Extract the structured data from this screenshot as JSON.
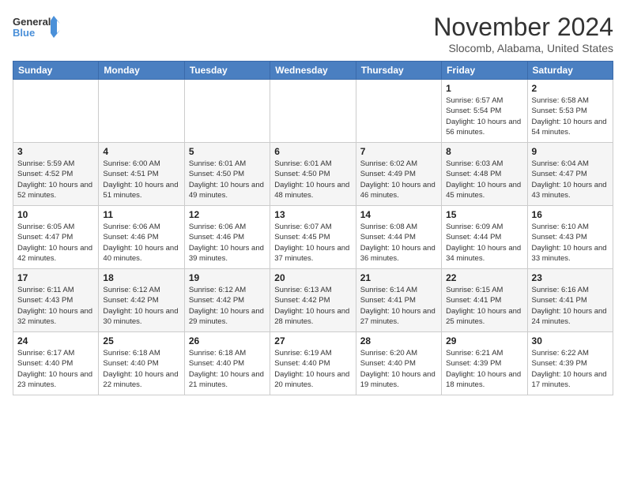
{
  "logo": {
    "line1": "General",
    "line2": "Blue"
  },
  "title": "November 2024",
  "location": "Slocomb, Alabama, United States",
  "days_of_week": [
    "Sunday",
    "Monday",
    "Tuesday",
    "Wednesday",
    "Thursday",
    "Friday",
    "Saturday"
  ],
  "weeks": [
    [
      {
        "day": "",
        "info": ""
      },
      {
        "day": "",
        "info": ""
      },
      {
        "day": "",
        "info": ""
      },
      {
        "day": "",
        "info": ""
      },
      {
        "day": "",
        "info": ""
      },
      {
        "day": "1",
        "info": "Sunrise: 6:57 AM\nSunset: 5:54 PM\nDaylight: 10 hours and 56 minutes."
      },
      {
        "day": "2",
        "info": "Sunrise: 6:58 AM\nSunset: 5:53 PM\nDaylight: 10 hours and 54 minutes."
      }
    ],
    [
      {
        "day": "3",
        "info": "Sunrise: 5:59 AM\nSunset: 4:52 PM\nDaylight: 10 hours and 52 minutes."
      },
      {
        "day": "4",
        "info": "Sunrise: 6:00 AM\nSunset: 4:51 PM\nDaylight: 10 hours and 51 minutes."
      },
      {
        "day": "5",
        "info": "Sunrise: 6:01 AM\nSunset: 4:50 PM\nDaylight: 10 hours and 49 minutes."
      },
      {
        "day": "6",
        "info": "Sunrise: 6:01 AM\nSunset: 4:50 PM\nDaylight: 10 hours and 48 minutes."
      },
      {
        "day": "7",
        "info": "Sunrise: 6:02 AM\nSunset: 4:49 PM\nDaylight: 10 hours and 46 minutes."
      },
      {
        "day": "8",
        "info": "Sunrise: 6:03 AM\nSunset: 4:48 PM\nDaylight: 10 hours and 45 minutes."
      },
      {
        "day": "9",
        "info": "Sunrise: 6:04 AM\nSunset: 4:47 PM\nDaylight: 10 hours and 43 minutes."
      }
    ],
    [
      {
        "day": "10",
        "info": "Sunrise: 6:05 AM\nSunset: 4:47 PM\nDaylight: 10 hours and 42 minutes."
      },
      {
        "day": "11",
        "info": "Sunrise: 6:06 AM\nSunset: 4:46 PM\nDaylight: 10 hours and 40 minutes."
      },
      {
        "day": "12",
        "info": "Sunrise: 6:06 AM\nSunset: 4:46 PM\nDaylight: 10 hours and 39 minutes."
      },
      {
        "day": "13",
        "info": "Sunrise: 6:07 AM\nSunset: 4:45 PM\nDaylight: 10 hours and 37 minutes."
      },
      {
        "day": "14",
        "info": "Sunrise: 6:08 AM\nSunset: 4:44 PM\nDaylight: 10 hours and 36 minutes."
      },
      {
        "day": "15",
        "info": "Sunrise: 6:09 AM\nSunset: 4:44 PM\nDaylight: 10 hours and 34 minutes."
      },
      {
        "day": "16",
        "info": "Sunrise: 6:10 AM\nSunset: 4:43 PM\nDaylight: 10 hours and 33 minutes."
      }
    ],
    [
      {
        "day": "17",
        "info": "Sunrise: 6:11 AM\nSunset: 4:43 PM\nDaylight: 10 hours and 32 minutes."
      },
      {
        "day": "18",
        "info": "Sunrise: 6:12 AM\nSunset: 4:42 PM\nDaylight: 10 hours and 30 minutes."
      },
      {
        "day": "19",
        "info": "Sunrise: 6:12 AM\nSunset: 4:42 PM\nDaylight: 10 hours and 29 minutes."
      },
      {
        "day": "20",
        "info": "Sunrise: 6:13 AM\nSunset: 4:42 PM\nDaylight: 10 hours and 28 minutes."
      },
      {
        "day": "21",
        "info": "Sunrise: 6:14 AM\nSunset: 4:41 PM\nDaylight: 10 hours and 27 minutes."
      },
      {
        "day": "22",
        "info": "Sunrise: 6:15 AM\nSunset: 4:41 PM\nDaylight: 10 hours and 25 minutes."
      },
      {
        "day": "23",
        "info": "Sunrise: 6:16 AM\nSunset: 4:41 PM\nDaylight: 10 hours and 24 minutes."
      }
    ],
    [
      {
        "day": "24",
        "info": "Sunrise: 6:17 AM\nSunset: 4:40 PM\nDaylight: 10 hours and 23 minutes."
      },
      {
        "day": "25",
        "info": "Sunrise: 6:18 AM\nSunset: 4:40 PM\nDaylight: 10 hours and 22 minutes."
      },
      {
        "day": "26",
        "info": "Sunrise: 6:18 AM\nSunset: 4:40 PM\nDaylight: 10 hours and 21 minutes."
      },
      {
        "day": "27",
        "info": "Sunrise: 6:19 AM\nSunset: 4:40 PM\nDaylight: 10 hours and 20 minutes."
      },
      {
        "day": "28",
        "info": "Sunrise: 6:20 AM\nSunset: 4:40 PM\nDaylight: 10 hours and 19 minutes."
      },
      {
        "day": "29",
        "info": "Sunrise: 6:21 AM\nSunset: 4:39 PM\nDaylight: 10 hours and 18 minutes."
      },
      {
        "day": "30",
        "info": "Sunrise: 6:22 AM\nSunset: 4:39 PM\nDaylight: 10 hours and 17 minutes."
      }
    ]
  ]
}
